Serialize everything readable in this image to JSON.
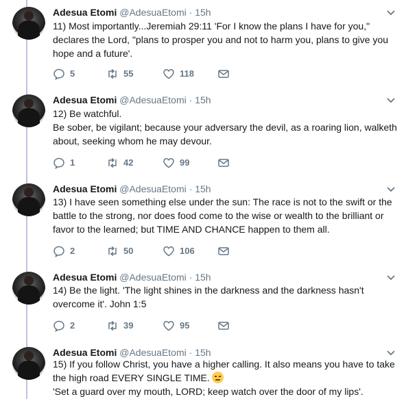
{
  "colors": {
    "thread_line": "#c5bfe0",
    "meta_gray": "#657786",
    "text": "#14171a"
  },
  "tweets": [
    {
      "name": "Adesua Etomi",
      "handle": "@AdesuaEtomi",
      "dot": "·",
      "time": "15h",
      "lines": [
        "11) Most importantly...Jeremiah 29:11 'For I know the plans I have for you,\"",
        "declares the Lord, \"plans to prosper you and not to harm you, plans to give you",
        "hope and a future'."
      ],
      "replies": "5",
      "retweets": "55",
      "likes": "118"
    },
    {
      "name": "Adesua Etomi",
      "handle": "@AdesuaEtomi",
      "dot": "·",
      "time": "15h",
      "lines": [
        "12) Be watchful.",
        "  Be sober, be vigilant; because your adversary the devil, as a roaring lion, walketh",
        "about, seeking whom he may devour."
      ],
      "replies": "1",
      "retweets": "42",
      "likes": "99"
    },
    {
      "name": "Adesua Etomi",
      "handle": "@AdesuaEtomi",
      "dot": "·",
      "time": "15h",
      "lines": [
        "13) I have seen something else under the sun: The race is not to the swift or the",
        "battle to the strong, nor does food come to the wise or wealth to the brilliant or",
        "favor to the learned; but TIME AND CHANCE happen to them all."
      ],
      "replies": "2",
      "retweets": "50",
      "likes": "106"
    },
    {
      "name": "Adesua Etomi",
      "handle": "@AdesuaEtomi",
      "dot": "·",
      "time": "15h",
      "lines": [
        "14) Be the light. 'The light shines in the darkness and the darkness hasn't",
        "overcome it'. John 1:5"
      ],
      "replies": "2",
      "retweets": "39",
      "likes": "95"
    },
    {
      "name": "Adesua Etomi",
      "handle": "@AdesuaEtomi",
      "dot": "·",
      "time": "15h",
      "lines": [
        "15) If you follow Christ, you have a higher calling. It also means you have to take",
        "the high road EVERY SINGLE TIME.",
        "'Set a guard over my mouth, LORD; keep watch over the door of my lips'."
      ],
      "emoji_icon": "unamused-face-emoji"
    }
  ]
}
